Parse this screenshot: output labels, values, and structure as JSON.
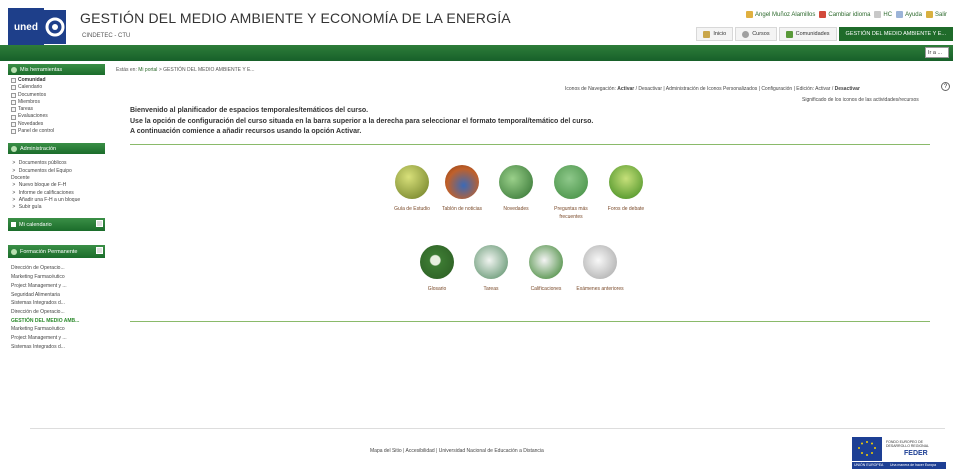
{
  "header": {
    "logo_text": "uned",
    "title": "GESTIÓN DEL MEDIO AMBIENTE Y ECONOMÍA DE LA ENERGÍA",
    "subtitle": "CINDETEC - CTU",
    "user_links": [
      "Angel Muñoz Alamillos",
      "Cambiar idioma",
      "HC",
      "Ayuda",
      "Salir"
    ],
    "nav_tabs": [
      "Inicio",
      "Cursos",
      "Comunidades",
      "GESTIÓN DEL MEDIO AMBIENTE Y E..."
    ],
    "goto_label": "Ir a ..."
  },
  "sidebar": {
    "tools": {
      "title": "Mis herramientas",
      "items": [
        "Comunidad",
        "Calendario",
        "Documentos",
        "Miembros",
        "Tareas",
        "Evaluaciones",
        "Novedades",
        "Panel de control"
      ]
    },
    "admin": {
      "title": "Administración",
      "items": [
        "Documentos públicos",
        "Documentos del Equipo"
      ],
      "docente_label": "Docente",
      "docente_items": [
        "Nuevo bloque de F-H",
        "Informe de calificaciones",
        "Añadir una F-H a un bloque",
        "Subir guía"
      ]
    },
    "calendar": {
      "title": "Mi calendario"
    },
    "formacion": {
      "title": "Formación Permanente",
      "items": [
        "Dirección de Operacio...",
        "Marketing Farmacéutico",
        "Project Management y ...",
        "Seguridad Alimentaria",
        "Sistemas Integrados d...",
        "Dirección de Operacio...",
        "GESTIÓN DEL MEDIO AMB...",
        "Marketing Farmacéutico",
        "Project Management y ...",
        "Sistemas Integrados d..."
      ]
    }
  },
  "main": {
    "breadcrumb_prefix": "Estás en:",
    "breadcrumb_link": "Mi portal",
    "breadcrumb_rest": "> GESTIÓN DEL MEDIO AMBIENTE Y E...",
    "icon_nav": {
      "label": "Iconos de Navegación:",
      "activar": "Activar",
      "sep1": "/ Desactivar | Administración de Iconos Personalizados | Configuración | Edición: Activar /",
      "desactivar": "Desactivar"
    },
    "significado": "Significado de los iconos de las actividades/recursos",
    "welcome_lines": [
      "Bienvenido al planificador de espacios temporales/temáticos del curso.",
      "Use la opción de configuración del curso situada en la barra superior a la derecha para seleccionar el formato temporal/temático del curso.",
      "A continuación comience a añadir recursos usando la opción Activar."
    ],
    "resources_row1": [
      {
        "label": "Guía de Estudio",
        "color": "#8a9a3a"
      },
      {
        "label": "Tablón de noticias",
        "color": "#b0541e"
      },
      {
        "label": "Novedades",
        "color": "#3e8a3e"
      },
      {
        "label": "Preguntas más frecuentes",
        "color": "#4f9a4f"
      },
      {
        "label": "Foros de debate",
        "color": "#5aa02c"
      }
    ],
    "resources_row2": [
      {
        "label": "Glosario",
        "color": "#3c7a32"
      },
      {
        "label": "Tareas",
        "color": "#7fa88a"
      },
      {
        "label": "Calificaciones",
        "color": "#6aa062"
      },
      {
        "label": "Exámenes anteriores",
        "color": "#b8b8b8"
      }
    ]
  },
  "footer": {
    "links": [
      "Mapa del Sitio",
      "Accesibilidad",
      "Universidad Nacional de Educación a Distancia"
    ],
    "feder_title": "FONDO EUROPEO DE DESARROLLO REGIONAL",
    "feder_label": "FEDER",
    "feder_motto": "Una manera de hacer Europa",
    "eu_label": "UNIÓN EUROPEA"
  }
}
